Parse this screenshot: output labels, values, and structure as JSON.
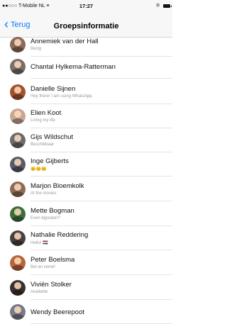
{
  "statusbar": {
    "carrier": "●●○○○ T-Mobile NL",
    "wifi": "≡",
    "time": "17:27",
    "bluetooth": "✱"
  },
  "nav": {
    "back_label": "Terug",
    "title": "Groepsinformatie"
  },
  "members": [
    {
      "name": "Annemiek van der Hall",
      "status": "Bezig",
      "color": "#8a6a58"
    },
    {
      "name": "Chantal Hylkema-Ratterman",
      "status": "",
      "color": "#7a6e66"
    },
    {
      "name": "Danielle Sijnen",
      "status": "Hey there! I am using WhatsApp.",
      "color": "#a0522d"
    },
    {
      "name": "Elien Koot",
      "status": "Living my life",
      "color": "#c9a893"
    },
    {
      "name": "Gijs Wildschut",
      "status": "Beschikbaar",
      "color": "#6d6a6a"
    },
    {
      "name": "Inge Gijberts",
      "status": "😊😊😊",
      "color": "#5a5a6a"
    },
    {
      "name": "Marjon Bloemkolk",
      "status": "At the movies",
      "color": "#8e6b55"
    },
    {
      "name": "Mette Bogman",
      "status": "Even bijpraten?",
      "color": "#3c6e3c"
    },
    {
      "name": "Nathalie Reddering",
      "status": "Hello! 🇳🇱",
      "color": "#4a4040"
    },
    {
      "name": "Peter Boelsma",
      "status": "Bel en vertel!",
      "color": "#b5653a"
    },
    {
      "name": "Viviën Stolker",
      "status": "Available",
      "color": "#3a3030"
    },
    {
      "name": "Wendy Beerepoot",
      "status": "",
      "color": "#7a7a88"
    }
  ]
}
